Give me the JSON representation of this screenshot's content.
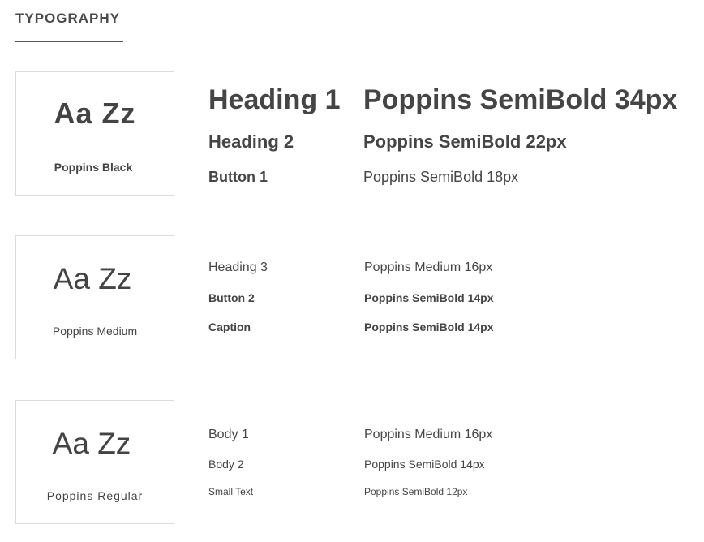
{
  "section": {
    "title": "TYPOGRAPHY"
  },
  "colors": {
    "text": "#454545",
    "card_border": "#dcdcdc",
    "underline": "#555555"
  },
  "groups": [
    {
      "sample": "Aa Zz",
      "font_name": "Poppins Black",
      "styles": [
        {
          "label": "Heading 1",
          "spec": "Poppins SemiBold 34px"
        },
        {
          "label": "Heading 2",
          "spec": "Poppins SemiBold 22px"
        },
        {
          "label": "Button 1",
          "spec": "Poppins SemiBold 18px"
        }
      ]
    },
    {
      "sample": "Aa Zz",
      "font_name": "Poppins Medium",
      "styles": [
        {
          "label": "Heading 3",
          "spec": "Poppins Medium 16px"
        },
        {
          "label": "Button 2",
          "spec": "Poppins SemiBold 14px"
        },
        {
          "label": "Caption",
          "spec": "Poppins SemiBold 14px"
        }
      ]
    },
    {
      "sample": "Aa Zz",
      "font_name": "Poppins Regular",
      "styles": [
        {
          "label": "Body 1",
          "spec": "Poppins Medium 16px"
        },
        {
          "label": "Body 2",
          "spec": "Poppins SemiBold 14px"
        },
        {
          "label": "Small Text",
          "spec": "Poppins SemiBold 12px"
        }
      ]
    }
  ]
}
